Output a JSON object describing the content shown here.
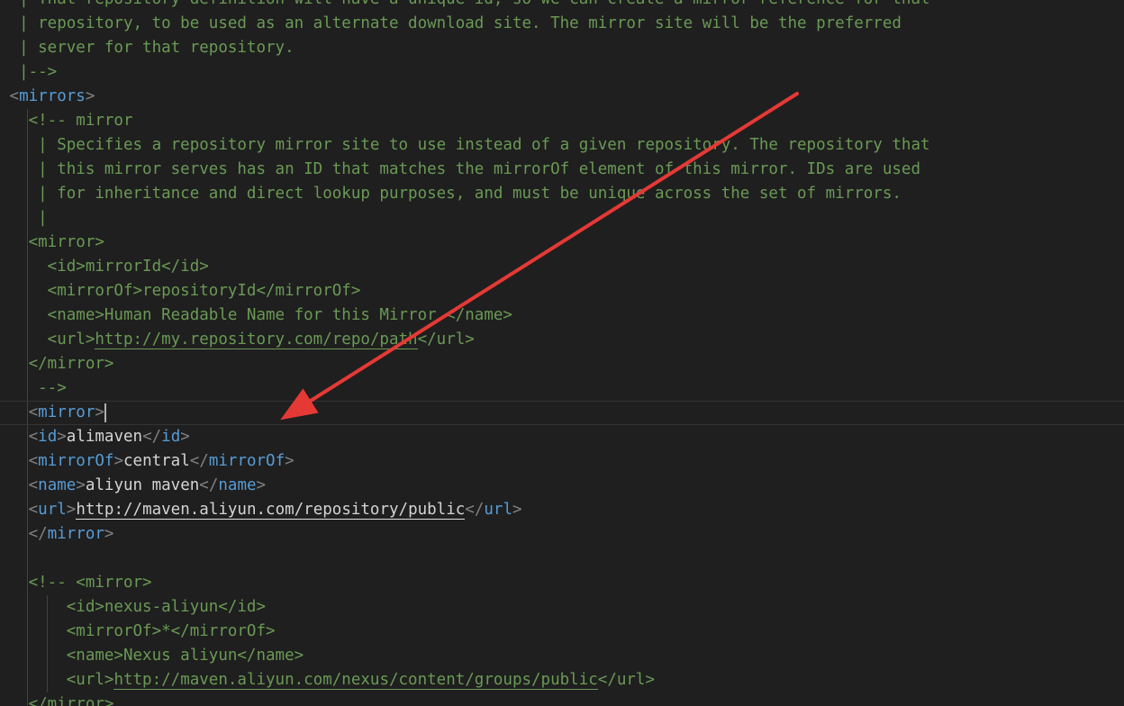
{
  "editor": {
    "language": "xml",
    "theme": {
      "background": "#1f1f1f",
      "comment": "#6a9955",
      "tag": "#569cd6",
      "bracket": "#808080",
      "text": "#d4d4d4"
    },
    "lines": [
      {
        "parts": [
          {
            "t": "  | That repository definition will have a unique id, so we can create a mirror reference for that",
            "s": "c"
          }
        ]
      },
      {
        "parts": [
          {
            "t": "  | repository, to be used as an alternate download site. The mirror site will be the preferred",
            "s": "c"
          }
        ]
      },
      {
        "parts": [
          {
            "t": "  | server for that repository.",
            "s": "c"
          }
        ]
      },
      {
        "parts": [
          {
            "t": "  |-->",
            "s": "c"
          }
        ]
      },
      {
        "parts": [
          {
            "t": " ",
            "s": "c"
          },
          {
            "t": "<",
            "s": "b"
          },
          {
            "t": "mirrors",
            "s": "g"
          },
          {
            "t": ">",
            "s": "b"
          }
        ]
      },
      {
        "parts": [
          {
            "t": "   <!-- mirror",
            "s": "c"
          }
        ]
      },
      {
        "parts": [
          {
            "t": "    | Specifies a repository mirror site to use instead of a given repository. The repository that",
            "s": "c"
          }
        ]
      },
      {
        "parts": [
          {
            "t": "    | this mirror serves has an ID that matches the mirrorOf element of this mirror. IDs are used",
            "s": "c"
          }
        ]
      },
      {
        "parts": [
          {
            "t": "    | for inheritance and direct lookup purposes, and must be unique across the set of mirrors.",
            "s": "c"
          }
        ]
      },
      {
        "parts": [
          {
            "t": "    |",
            "s": "c"
          }
        ]
      },
      {
        "parts": [
          {
            "t": "   <mirror>",
            "s": "c"
          }
        ]
      },
      {
        "parts": [
          {
            "t": "     <id>mirrorId</id>",
            "s": "c"
          }
        ]
      },
      {
        "parts": [
          {
            "t": "     <mirrorOf>repositoryId</mirrorOf>",
            "s": "c"
          }
        ]
      },
      {
        "parts": [
          {
            "t": "     <name>Human Readable Name for this Mirror.</name>",
            "s": "c"
          }
        ]
      },
      {
        "parts": [
          {
            "t": "     <url>",
            "s": "c"
          },
          {
            "t": "http://my.repository.com/repo/path",
            "s": "uc"
          },
          {
            "t": "</url>",
            "s": "c"
          }
        ]
      },
      {
        "parts": [
          {
            "t": "   </mirror>",
            "s": "c"
          }
        ]
      },
      {
        "parts": [
          {
            "t": "    -->",
            "s": "c"
          }
        ]
      },
      {
        "current": true,
        "cursor_after": true,
        "parts": [
          {
            "t": "   ",
            "s": "c"
          },
          {
            "t": "<",
            "s": "b"
          },
          {
            "t": "mirror",
            "s": "g"
          },
          {
            "t": ">",
            "s": "b"
          }
        ]
      },
      {
        "parts": [
          {
            "t": "   ",
            "s": "c"
          },
          {
            "t": "<",
            "s": "b"
          },
          {
            "t": "id",
            "s": "g"
          },
          {
            "t": ">",
            "s": "b"
          },
          {
            "t": "alimaven",
            "s": "x"
          },
          {
            "t": "</",
            "s": "b"
          },
          {
            "t": "id",
            "s": "g"
          },
          {
            "t": ">",
            "s": "b"
          }
        ]
      },
      {
        "parts": [
          {
            "t": "   ",
            "s": "c"
          },
          {
            "t": "<",
            "s": "b"
          },
          {
            "t": "mirrorOf",
            "s": "g"
          },
          {
            "t": ">",
            "s": "b"
          },
          {
            "t": "central",
            "s": "x"
          },
          {
            "t": "</",
            "s": "b"
          },
          {
            "t": "mirrorOf",
            "s": "g"
          },
          {
            "t": ">",
            "s": "b"
          }
        ]
      },
      {
        "parts": [
          {
            "t": "   ",
            "s": "c"
          },
          {
            "t": "<",
            "s": "b"
          },
          {
            "t": "name",
            "s": "g"
          },
          {
            "t": ">",
            "s": "b"
          },
          {
            "t": "aliyun maven",
            "s": "x"
          },
          {
            "t": "</",
            "s": "b"
          },
          {
            "t": "name",
            "s": "g"
          },
          {
            "t": ">",
            "s": "b"
          }
        ]
      },
      {
        "parts": [
          {
            "t": "   ",
            "s": "c"
          },
          {
            "t": "<",
            "s": "b"
          },
          {
            "t": "url",
            "s": "g"
          },
          {
            "t": ">",
            "s": "b"
          },
          {
            "t": "http://maven.aliyun.com/repository/public",
            "s": "ua"
          },
          {
            "t": "</",
            "s": "b"
          },
          {
            "t": "url",
            "s": "g"
          },
          {
            "t": ">",
            "s": "b"
          }
        ]
      },
      {
        "parts": [
          {
            "t": "   ",
            "s": "c"
          },
          {
            "t": "</",
            "s": "b"
          },
          {
            "t": "mirror",
            "s": "g"
          },
          {
            "t": ">",
            "s": "b"
          }
        ]
      },
      {
        "parts": [
          {
            "t": "",
            "s": "c"
          }
        ]
      },
      {
        "parts": [
          {
            "t": "   <!-- <mirror>",
            "s": "c"
          }
        ]
      },
      {
        "parts": [
          {
            "t": "       <id>nexus-aliyun</id>",
            "s": "c"
          }
        ]
      },
      {
        "parts": [
          {
            "t": "       <mirrorOf>*</mirrorOf>",
            "s": "c"
          }
        ]
      },
      {
        "parts": [
          {
            "t": "       <name>Nexus aliyun</name>",
            "s": "c"
          }
        ]
      },
      {
        "parts": [
          {
            "t": "       <url>",
            "s": "c"
          },
          {
            "t": "http://maven.aliyun.com/nexus/content/groups/public",
            "s": "uc"
          },
          {
            "t": "</url>",
            "s": "c"
          }
        ]
      },
      {
        "parts": [
          {
            "t": "   </mirror>",
            "s": "c"
          }
        ]
      }
    ]
  },
  "annotation": {
    "type": "arrow",
    "color": "#e53935"
  }
}
